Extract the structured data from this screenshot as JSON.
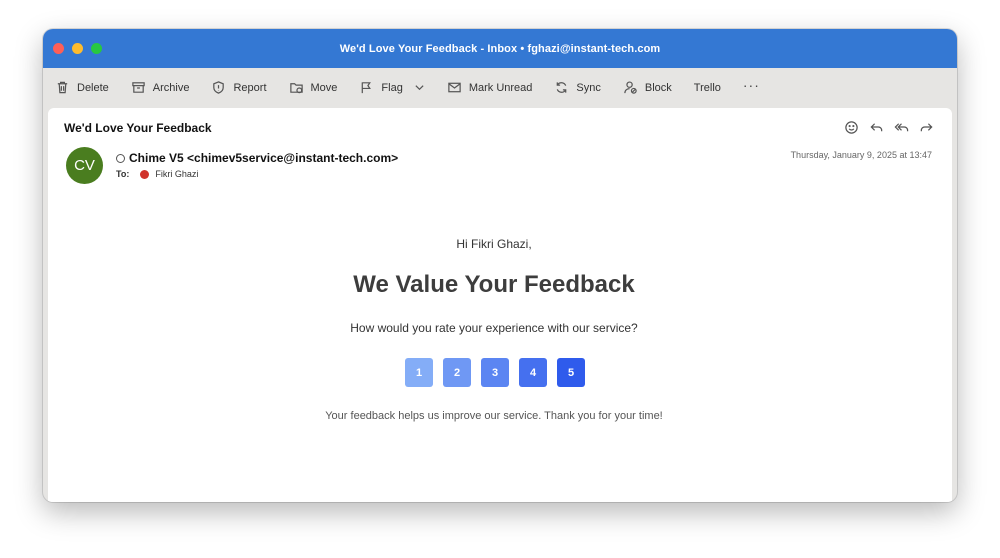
{
  "window": {
    "title": "We'd Love Your Feedback - Inbox • fghazi@instant-tech.com"
  },
  "toolbar": {
    "delete": "Delete",
    "archive": "Archive",
    "report": "Report",
    "move": "Move",
    "flag": "Flag",
    "mark_unread": "Mark Unread",
    "sync": "Sync",
    "block": "Block",
    "trello": "Trello",
    "more": "···"
  },
  "message": {
    "subject": "We'd Love Your Feedback",
    "avatar_initials": "CV",
    "avatar_color": "#4a7d1f",
    "sender": "Chime V5 <chimev5service@instant-tech.com>",
    "to_label": "To:",
    "recipient": "Fikri Ghazi",
    "date": "Thursday, January 9, 2025 at 13:47"
  },
  "email_body": {
    "greeting": "Hi Fikri Ghazi,",
    "heading": "We Value Your Feedback",
    "question": "How would you rate your experience with our service?",
    "ratings": [
      {
        "label": "1",
        "color": "#84adf7"
      },
      {
        "label": "2",
        "color": "#6f98f4"
      },
      {
        "label": "3",
        "color": "#5b85f2"
      },
      {
        "label": "4",
        "color": "#4570ef"
      },
      {
        "label": "5",
        "color": "#2f5bec"
      }
    ],
    "thanks": "Your feedback helps us improve our service. Thank you for your time!"
  },
  "colors": {
    "titlebar": "#3478d3",
    "accent_red": "#d0342c"
  }
}
